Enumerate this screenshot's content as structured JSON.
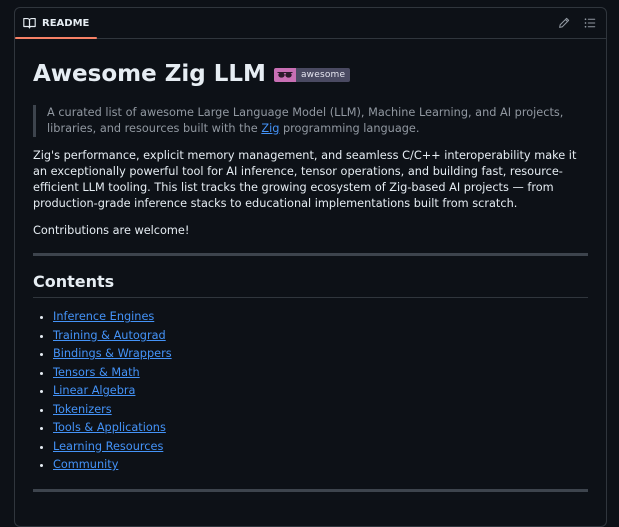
{
  "header": {
    "tab_label": "README",
    "tab_icon": "book-icon",
    "actions": [
      {
        "name": "edit",
        "icon": "pencil-icon"
      },
      {
        "name": "outline",
        "icon": "list-icon"
      }
    ]
  },
  "readme": {
    "title": "Awesome Zig LLM",
    "badge": {
      "icon": "sunglasses-icon",
      "text": "awesome",
      "left_color": "#c86fb4",
      "right_color": "#4a4a62"
    },
    "blockquote": {
      "before_link": "A curated list of awesome Large Language Model (LLM), Machine Learning, and AI projects, libraries, and resources built with the ",
      "link_text": "Zig",
      "after_link": " programming language."
    },
    "intro": "Zig's performance, explicit memory management, and seamless C/C++ interoperability make it an exceptionally powerful tool for AI inference, tensor operations, and building fast, resource-efficient LLM tooling. This list tracks the growing ecosystem of Zig-based AI projects — from production-grade inference stacks to educational implementations built from scratch.",
    "contributions": "Contributions are welcome!",
    "contents_heading": "Contents",
    "contents": [
      "Inference Engines",
      "Training & Autograd",
      "Bindings & Wrappers",
      "Tensors & Math",
      "Linear Algebra",
      "Tokenizers",
      "Tools & Applications",
      "Learning Resources",
      "Community"
    ]
  },
  "colors": {
    "background": "#0d1117",
    "text": "#e6edf3",
    "muted": "#9198a1",
    "link": "#4493f8",
    "tab_underline": "#f78166",
    "border": "#30363d"
  }
}
